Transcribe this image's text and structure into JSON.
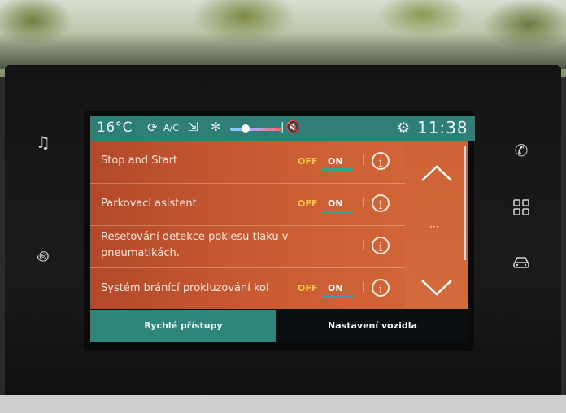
{
  "status_bar": {
    "temperature": "16°C",
    "ac_label": "A/C",
    "time": "11:38"
  },
  "settings": [
    {
      "label": "Stop and Start",
      "off_label": "OFF",
      "on_label": "ON",
      "state": "on"
    },
    {
      "label": "Parkovací asistent",
      "off_label": "OFF",
      "on_label": "ON",
      "state": "on"
    },
    {
      "label": "Resetování detekce poklesu tlaku v pneumatikách."
    },
    {
      "label": "Systém bránící prokluzování kol",
      "off_label": "OFF",
      "on_label": "ON",
      "state": "on"
    }
  ],
  "tabs": {
    "left_label": "Rychlé přístupy",
    "right_label": "Nastavení vozidla"
  },
  "colors": {
    "status_bar": "#2f7f78",
    "list_background": "#c85a31",
    "off_text": "#ffc24a",
    "on_underline": "#39a18f",
    "active_tab": "#2f857c",
    "inactive_tab": "#0a0f12"
  },
  "icons": {
    "left_panel": [
      "music-note-icon",
      "climate-seat-icon"
    ],
    "right_panel": [
      "phone-icon",
      "apps-grid-icon",
      "car-icon"
    ]
  }
}
